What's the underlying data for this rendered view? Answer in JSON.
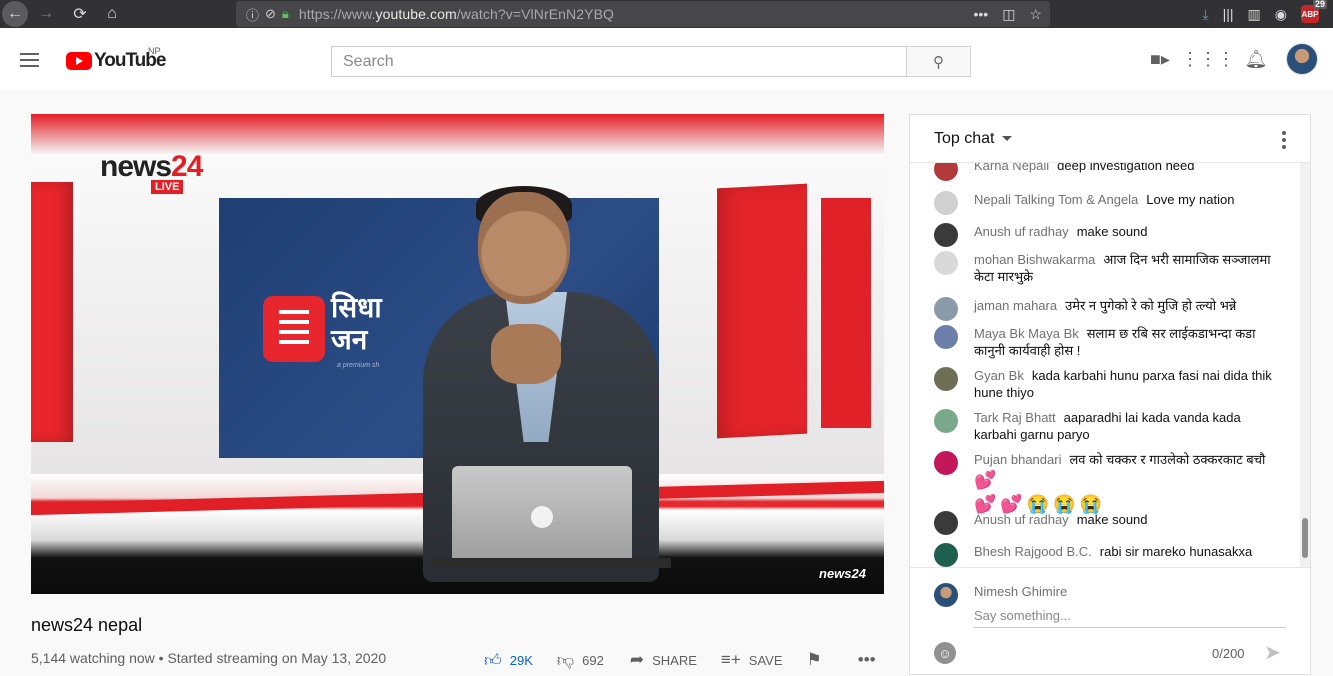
{
  "browser": {
    "url_prefix": "https://www.",
    "url_host": "youtube.com",
    "url_path": "/watch?v=VlNrEnN2YBQ",
    "abp_label": "ABP",
    "abp_count": "29"
  },
  "masthead": {
    "logo_text": "YouTube",
    "country": "NP",
    "search_placeholder": "Search"
  },
  "video": {
    "title": "news24 nepal",
    "watching": "5,144 watching now",
    "started": "Started streaming on May 13, 2020",
    "likes": "29K",
    "dislikes": "692",
    "share_label": "SHARE",
    "save_label": "SAVE"
  },
  "player": {
    "brand_news": "news",
    "brand_num": "24",
    "live_label": "LIVE",
    "screen_line1": "सिधा",
    "screen_line2": "जन",
    "screen_sub": "a premium sh",
    "bug": "news24"
  },
  "chat": {
    "title": "Top chat",
    "messages": [
      {
        "author": "Karna Nepali",
        "text": "deep investigation need",
        "avatar_color": "#b23a3a"
      },
      {
        "author": "Nepali Talking Tom & Angela",
        "text": "Love my nation",
        "avatar_color": "#cfcfcf"
      },
      {
        "author": "Anush uf radhay",
        "text": "make sound",
        "avatar_color": "#3a3a3a"
      },
      {
        "author": "mohan Bishwakarma",
        "text": "आज दिन भरी सामाजिक सञ्जालमा केटा मारभुक्रे",
        "avatar_color": "#d9d9d9"
      },
      {
        "author": "jaman mahara",
        "text": "उमेर न पुगेको रे को मुजि हो त्ल्यो भन्ने",
        "avatar_color": "#8a9aa8"
      },
      {
        "author": "Maya Bk Maya Bk",
        "text": "सलाम छ रबि सर लाईकडाभन्दा कडा कानुनी कार्यवाही होस !",
        "avatar_color": "#6b7fa8"
      },
      {
        "author": "Gyan Bk",
        "text": "kada karbahi hunu parxa fasi nai dida thik hune thiyo",
        "avatar_color": "#6f6f55"
      },
      {
        "author": "Tark Raj Bhatt",
        "text": "aaparadhi lai kada vanda kada karbahi garnu paryo",
        "avatar_color": "#7aa88a"
      },
      {
        "author": "Pujan bhandari",
        "text": "लव को चक्कर र गाउलेको ठक्करकाट बचौ",
        "avatar_color": "#c2185b",
        "emojis": [
          "💕",
          "💕",
          "💕",
          "😭",
          "😭",
          "😭"
        ]
      },
      {
        "author": "Anush uf radhay",
        "text": "make sound",
        "avatar_color": "#3a3a3a"
      },
      {
        "author": "Bhesh Rajgood B.C.",
        "text": "rabi sir mareko hunasakxa",
        "avatar_color": "#1f5f4f"
      }
    ],
    "user_name": "Nimesh Ghimire",
    "input_placeholder": "Say something...",
    "char_count": "0/200"
  },
  "colors": {
    "youtube_red": "#ff0000",
    "like_blue": "#065fd4",
    "jump_blue": "#2196f3"
  }
}
